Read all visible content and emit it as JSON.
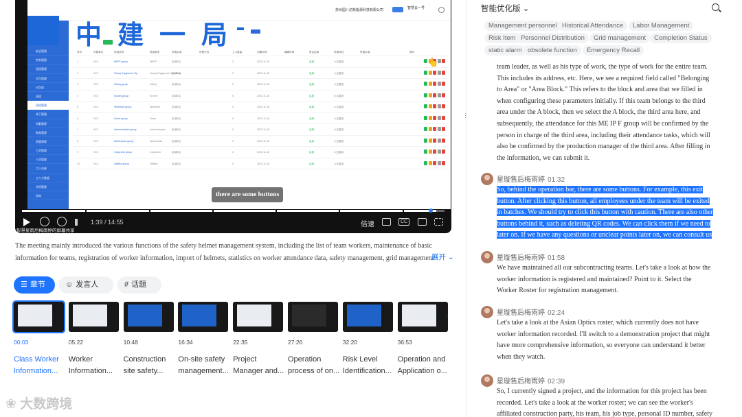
{
  "video": {
    "app_project": "苏州国八达新能源科技有限公司",
    "app_user": "智慧云一号",
    "logo_text": "中建一局",
    "sidebar": [
      "安全管理",
      "劳务管理",
      "班组管理",
      "分包管理",
      "分包商",
      "班组",
      "班组管理",
      "线下管理",
      "考勤管理",
      "教育管理",
      "质量管理",
      "工资管理",
      "人员管理",
      "工人台账",
      "工人大数据",
      "合同管理",
      "用电"
    ],
    "table_header": [
      "序号",
      "所属单位",
      "班组名称",
      "班组类型",
      "所属区域",
      "所属分包",
      "工人数量",
      "创建时间",
      "编辑时间",
      "是否启用",
      "所属项目",
      "所属区域",
      "操作"
    ],
    "rows": [
      {
        "no": "1",
        "unit": "XXX",
        "name": "MEPF group",
        "type": "MEPF",
        "area": "区域A区",
        "count": "3",
        "date": "2023-11-16",
        "st": "启用",
        "proj": "六达建设"
      },
      {
        "no": "2",
        "unit": "XXX",
        "name": "Heavy Equipment Op",
        "type": "Heavy Equipment Operators",
        "area": "区域A区",
        "count": "0",
        "date": "2023-11-16",
        "st": "启用",
        "proj": "六达建设"
      },
      {
        "no": "3",
        "unit": "XXX",
        "name": "Safety group",
        "type": "Safety",
        "area": "区域A区",
        "count": "0",
        "date": "2023-11-16",
        "st": "启用",
        "proj": "六达建设"
      },
      {
        "no": "4",
        "unit": "XXX",
        "name": "Survey group",
        "type": "Survey",
        "area": "区域A区",
        "count": "0",
        "date": "2023-11-16",
        "st": "启用",
        "proj": "六达建设"
      },
      {
        "no": "5",
        "unit": "XXX",
        "name": "Steelman group",
        "type": "Steelman",
        "area": "区域A区",
        "count": "0",
        "date": "2023-11-16",
        "st": "启用",
        "proj": "六达建设"
      },
      {
        "no": "6",
        "unit": "XXX",
        "name": "Driver group",
        "type": "Driver",
        "area": "区域A区",
        "count": "0",
        "date": "2023-11-16",
        "st": "启用",
        "proj": "六达建设"
      },
      {
        "no": "7",
        "unit": "XXX",
        "name": "Administrative group",
        "type": "Administrative",
        "area": "区域A区",
        "count": "0",
        "date": "2023-11-16",
        "st": "启用",
        "proj": "六达建设"
      },
      {
        "no": "8",
        "unit": "XXX",
        "name": "Warehouse group",
        "type": "Warehouse",
        "area": "区域A区",
        "count": "0",
        "date": "2023-11-16",
        "st": "启用",
        "proj": "六达建设"
      },
      {
        "no": "9",
        "unit": "XXX",
        "name": "Carpenter group",
        "type": "Carpenter",
        "area": "区域A区",
        "count": "0",
        "date": "2023-11-16",
        "st": "启用",
        "proj": "六达建设"
      },
      {
        "no": "10",
        "unit": "XXX",
        "name": "Utilities group",
        "type": "Utilities",
        "area": "区域A区",
        "count": "0",
        "date": "2023-11-16",
        "st": "启用",
        "proj": "六达建设"
      }
    ],
    "subtitle": "there are some buttons",
    "time": "1:39 / 14:55",
    "speed": "倍速",
    "cc": "CC",
    "watermark": "智慧星雨后梅雨婷的屏幕共享",
    "progress": 0.98,
    "accent": "#1e73ff"
  },
  "description": {
    "text": "The meeting mainly introduced the various functions of the safety helmet management system, including the list of team workers, maintenance of basic information for teams, registration of worker information, import of helmets, statistics on worker attendance data, safety management, grid management",
    "expand_label": "展开"
  },
  "tabs": [
    {
      "label": "章节",
      "icon": "list-icon"
    },
    {
      "label": "发言人",
      "icon": "person-icon"
    },
    {
      "label": "话题",
      "icon": "hash-icon"
    }
  ],
  "chapters": [
    {
      "time": "00:03",
      "title_l1": "Class Worker",
      "title_l2": "Information..."
    },
    {
      "time": "05:22",
      "title_l1": "Worker",
      "title_l2": "Information..."
    },
    {
      "time": "10:48",
      "title_l1": "Construction",
      "title_l2": "site safety..."
    },
    {
      "time": "16:34",
      "title_l1": "On-site safety",
      "title_l2": "management..."
    },
    {
      "time": "22:35",
      "title_l1": "Project",
      "title_l2": "Manager and..."
    },
    {
      "time": "27:26",
      "title_l1": "Operation",
      "title_l2": "process of on..."
    },
    {
      "time": "32:20",
      "title_l1": "Risk Level",
      "title_l2": "Identification..."
    },
    {
      "time": "36:53",
      "title_l1": "Operation and",
      "title_l2": "Application o..."
    }
  ],
  "footer_watermark": "大数跨境",
  "right": {
    "title": "智能优化版",
    "topics": [
      "Management personnel",
      "Historical Attendance",
      "Labor Management",
      "Risk Item",
      "Personnel Distribution",
      "Grid management",
      "Completion Status",
      "static alarm",
      "obsolete function",
      "Emergency Recall"
    ],
    "top_para": "team leader, as well as his type of work, the type of work for the entire team. This includes its address, etc. Here, we see a required field called \"Belonging to Area\" or \"Area Block.\" This refers to the block and area that we filled in when configuring these parameters initially. If this team belongs to the third area under the A block, then we select the A block, the third area here, and subsequently, the attendance for this ME IP F group will be confirmed by the person in charge of the third area, including their attendance tasks, which will also be confirmed by the production manager of the third area. After filling in the information, we can submit it.",
    "entries": [
      {
        "speaker": "星璇售后梅雨婷",
        "time": "01:32",
        "text": "So, behind the operation bar, there are some buttons. For example, this exit button. After clicking this button, all employees under the team will be exited in batches. We should try to click this button with caution. There are also other buttons behind it, such as deleting QR codes. We can click them if we need to later on. If we have any questions or unclear points later on, we can consult us",
        "highlight": true
      },
      {
        "speaker": "星璇售后梅雨婷",
        "time": "01:58",
        "text": "We have maintained all our subcontracting teams. Let's take a look at how the worker information is registered and maintained? Point to it. Select the Worker Roster for registration management.",
        "highlight": false
      },
      {
        "speaker": "星璇售后梅雨婷",
        "time": "02:24",
        "text": "Let's take a look at the Asian Optics roster, which currently does not have worker information recorded. I'll switch to a demonstration project that might have more comprehensive information, so everyone can understand it better when they watch.",
        "highlight": false
      },
      {
        "speaker": "星璇售后梅雨婷",
        "time": "02:39",
        "text": "So, I currently signed a project, and the information for this project has been recorded. Let's take a look at the worker roster; we can see the worker's affiliated construction party, his team, his job type, personal ID number, safety",
        "highlight": false
      }
    ]
  }
}
